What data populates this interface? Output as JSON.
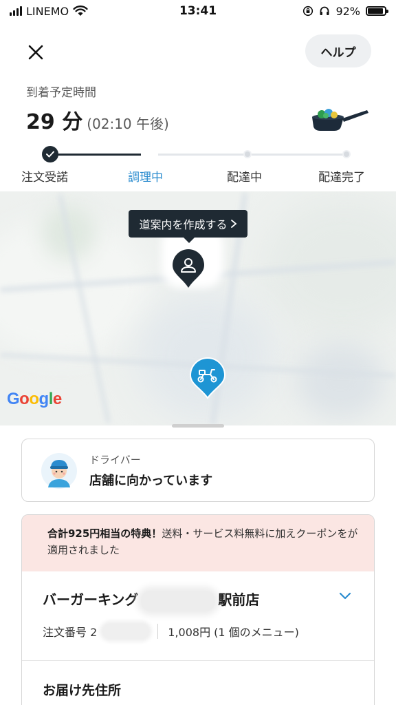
{
  "status_bar": {
    "carrier": "LINEMO",
    "time": "13:41",
    "battery": "92%",
    "battery_level": 0.92,
    "icons": [
      "signal-icon",
      "wifi-icon",
      "orientation-lock-icon",
      "headphones-icon",
      "battery-icon"
    ]
  },
  "header": {
    "close_icon": "close-icon",
    "help_label": "ヘルプ"
  },
  "eta": {
    "label": "到着予定時間",
    "minutes": "29 分",
    "clock": "(02:10 午後)",
    "illustration": "frying-pan-icon"
  },
  "progress": {
    "steps": [
      {
        "label": "注文受諾",
        "state": "done"
      },
      {
        "label": "調理中",
        "state": "active"
      },
      {
        "label": "配達中",
        "state": "pending"
      },
      {
        "label": "配達完了",
        "state": "pending"
      }
    ]
  },
  "map": {
    "tooltip": "道案内を作成する",
    "tooltip_icon": "chevron-right-icon",
    "user_pin_icon": "person-icon",
    "courier_pin_icon": "scooter-icon",
    "attribution": [
      "G",
      "o",
      "o",
      "g",
      "l",
      "e"
    ]
  },
  "driver": {
    "role": "ドライバー",
    "status": "店舗に向かっています",
    "avatar_icon": "driver-avatar-icon"
  },
  "order": {
    "promo_bold": "合計925円相当の特典！",
    "promo_rest": "送料・サービス料無料に加えクーポンをが適用されました",
    "store_name_start": "バーガーキング",
    "store_name_end": "駅前店",
    "order_number_label": "注文番号 2",
    "total": "1,008円 (1 個のメニュー)",
    "address_title": "お届け先住所"
  },
  "colors": {
    "accent_blue": "#2b8ccf",
    "pin_blue": "#1e95d4",
    "dark": "#1f2a33",
    "promo_bg": "#fbe6e3"
  }
}
